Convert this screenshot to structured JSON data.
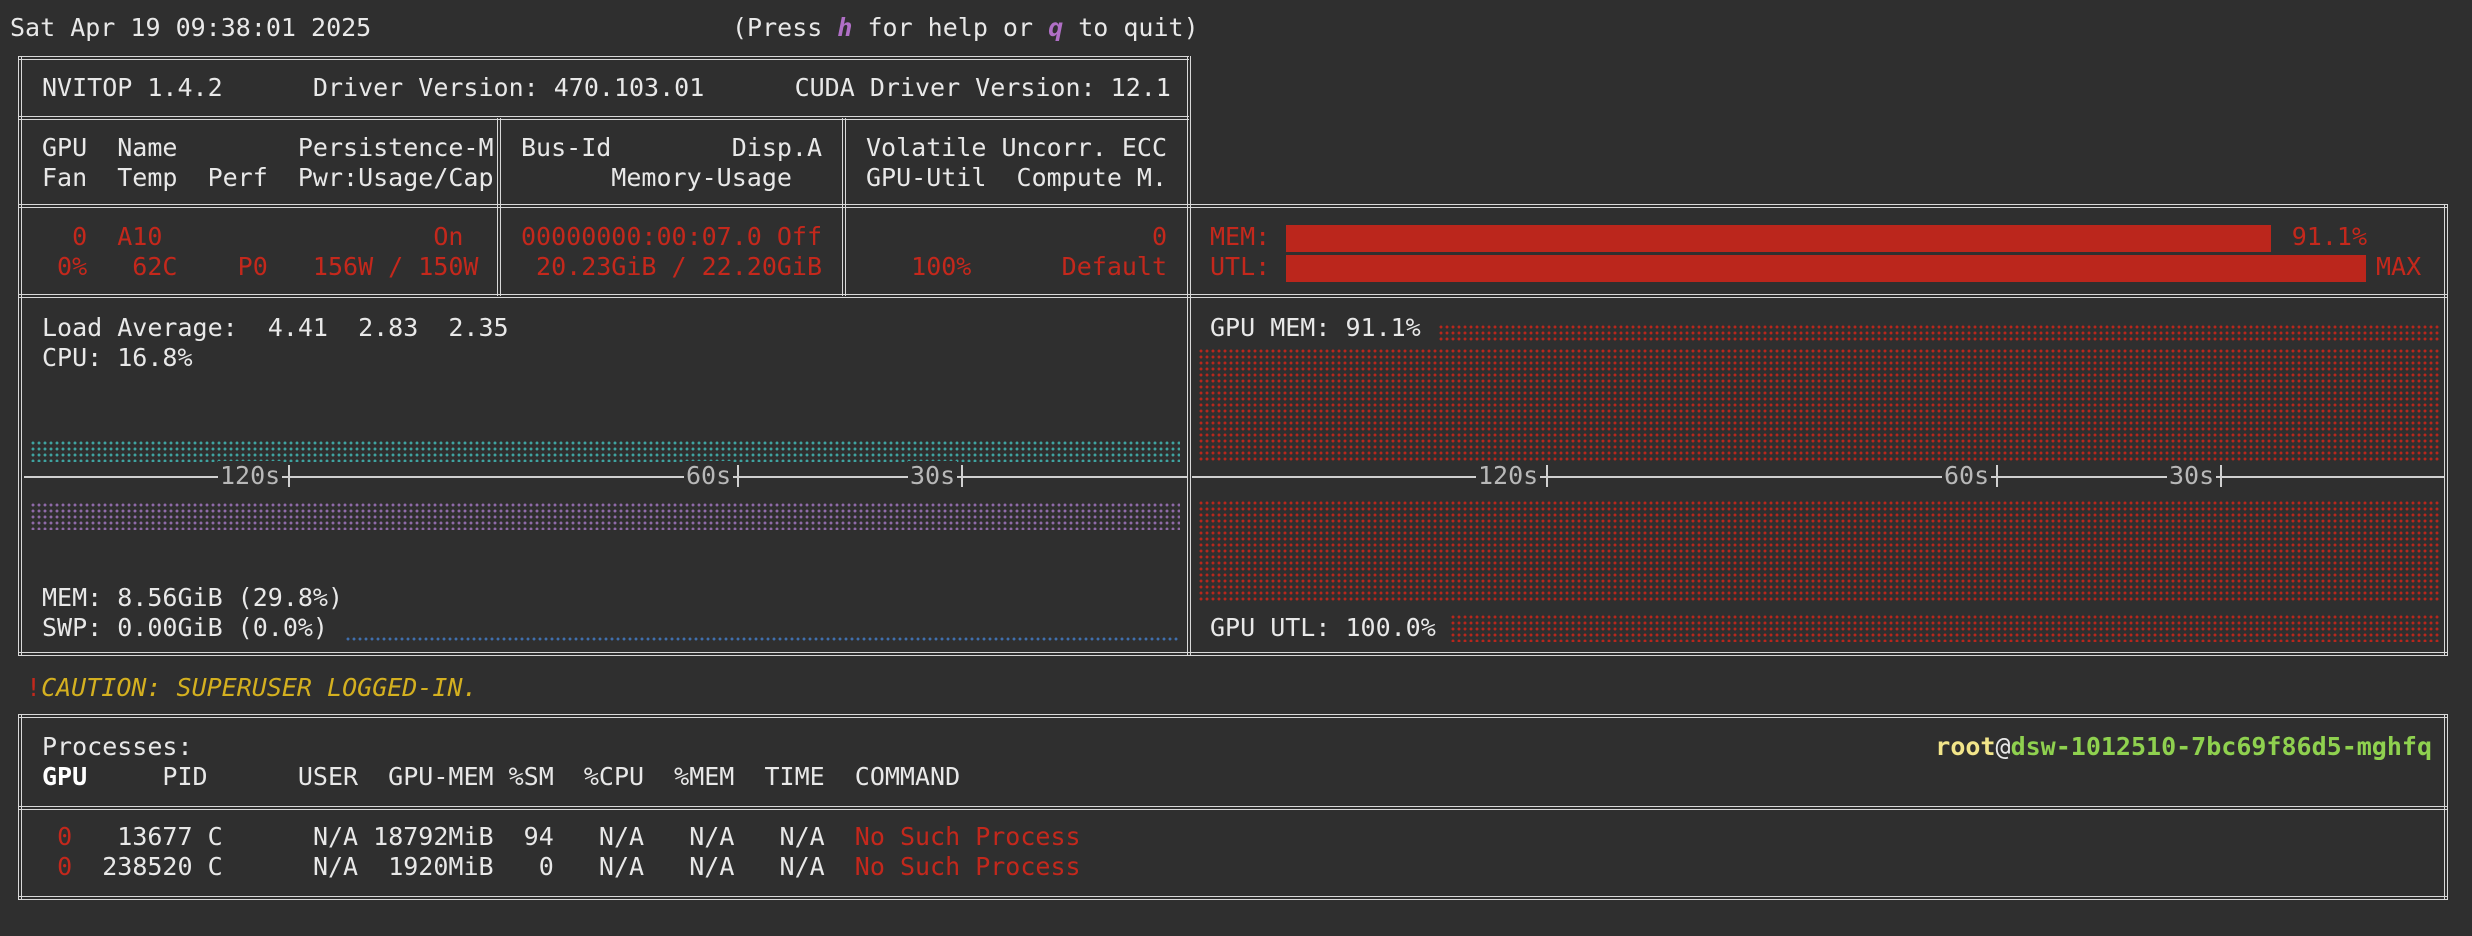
{
  "header": {
    "datetime": "Sat Apr 19 09:38:01 2025",
    "help_open": "(Press ",
    "help_key": "h",
    "help_mid": " for help or ",
    "quit_key": "q",
    "help_close": " to quit)"
  },
  "gpu_table": {
    "version_line": "NVITOP 1.4.2      Driver Version: 470.103.01      CUDA Driver Version: 12.1",
    "headers": {
      "col1_line1": "GPU  Name        Persistence-M",
      "col1_line2": "Fan  Temp  Perf  Pwr:Usage/Cap",
      "col2_line1": "Bus-Id        Disp.A",
      "col2_line2": "      Memory-Usage",
      "col3_line1": "Volatile Uncorr. ECC",
      "col3_line2": "GPU-Util  Compute M."
    },
    "row": {
      "col1_line1": "  0  A10                  On",
      "col1_line2": " 0%   62C    P0   156W / 150W",
      "col2_line1": "00000000:00:07.0 Off",
      "col2_line2": " 20.23GiB / 22.20GiB",
      "col3_line1": "                   0",
      "col3_line2": "   100%      Default"
    },
    "bars": {
      "mem_label": "MEM:",
      "mem_value": "91.1%",
      "mem_fraction": 0.911,
      "utl_label": "UTL:",
      "utl_value": "MAX",
      "utl_fraction": 1.0
    }
  },
  "host_panel": {
    "load_average": "Load Average:  4.41  2.83  2.35",
    "cpu": "CPU: 16.8%",
    "mem": "MEM: 8.56GiB (29.8%)",
    "swp": "SWP: 0.00GiB (0.0%)",
    "ticks": [
      "120s",
      "60s",
      "30s"
    ]
  },
  "gpu_panel": {
    "gpu_mem": "GPU MEM: 91.1%",
    "gpu_utl": "GPU UTL: 100.0%",
    "ticks": [
      "120s",
      "60s",
      "30s"
    ]
  },
  "caution": {
    "mark": "!",
    "text": "CAUTION: SUPERUSER LOGGED-IN."
  },
  "processes": {
    "title": "Processes:",
    "user": "root",
    "at": "@",
    "host": "dsw-1012510-7bc69f86d5-mghfq",
    "header_gpu": "GPU",
    "header_rest": "     PID      USER  GPU-MEM %SM  %CPU  %MEM  TIME  COMMAND",
    "rows": [
      {
        "gpu": "0",
        "rest": "   13677 C      N/A 18792MiB  94   N/A   N/A   N/A  ",
        "command": "No Such Process"
      },
      {
        "gpu": "0",
        "rest": "  238520 C      N/A  1920MiB   0   N/A   N/A   N/A  ",
        "command": "No Such Process"
      }
    ]
  },
  "colors": {
    "background": "#2f2f2f",
    "accent_red": "#bb261c",
    "host_cpu_dots": "#3fa3a0",
    "host_mem_dots": "#8f6aa8",
    "host_swp_dots": "#3f6fae",
    "caution": "#d4b020"
  }
}
